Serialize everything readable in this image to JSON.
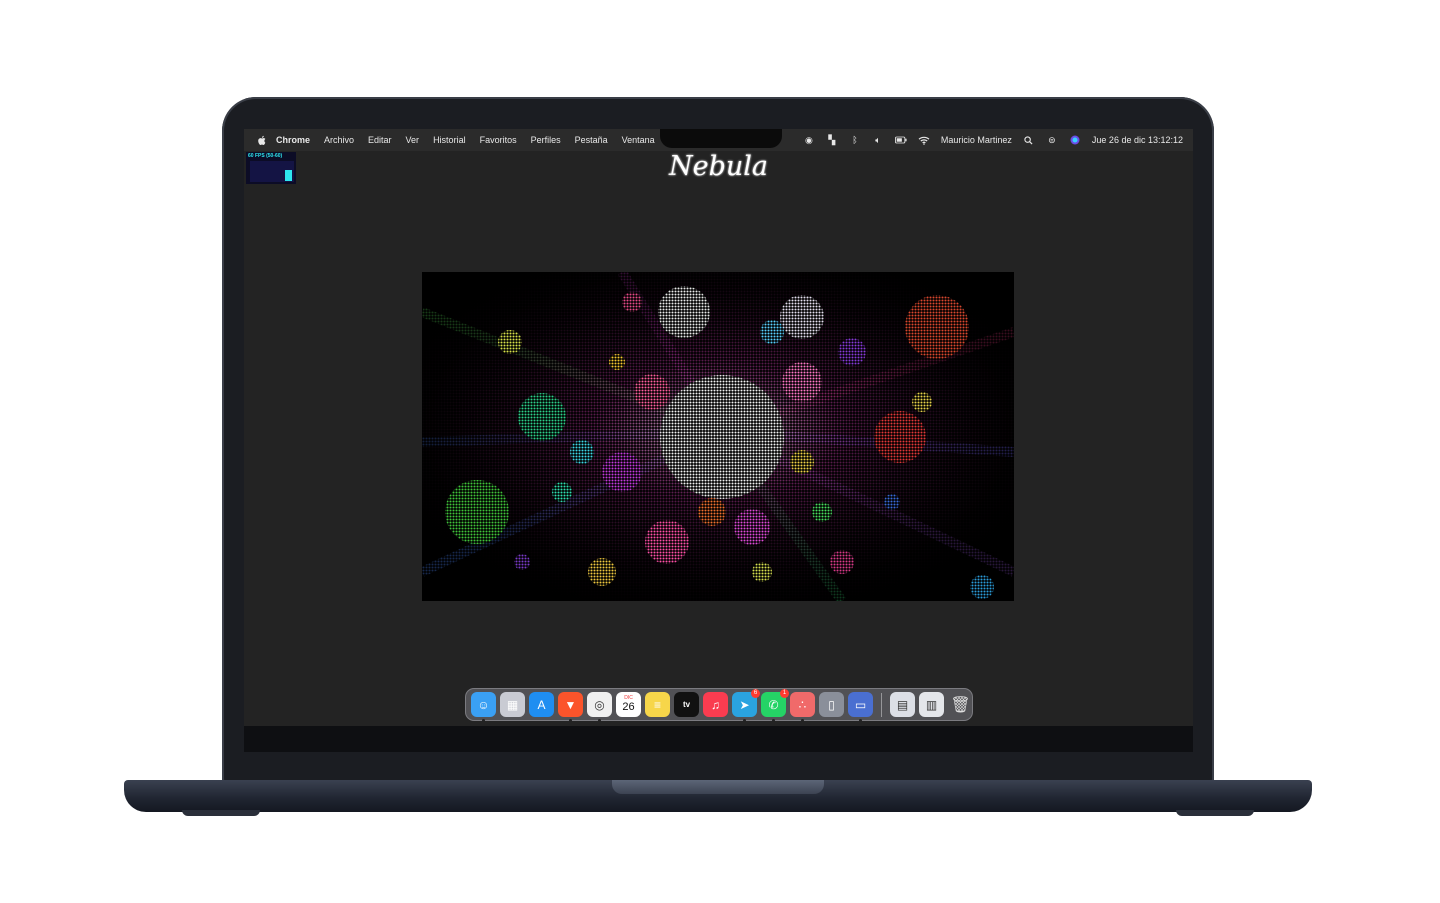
{
  "menubar": {
    "apple_icon": "apple-logo-icon",
    "items": [
      "Chrome",
      "Archivo",
      "Editar",
      "Ver",
      "Historial",
      "Favoritos",
      "Perfiles",
      "Pestaña",
      "Ventana"
    ],
    "status": {
      "user": "Mauricio Martinez",
      "datetime": "Jue 26 de dic  13:12:12"
    }
  },
  "fps": {
    "label": "60 FPS (50-60)"
  },
  "page": {
    "title": "Nebula"
  },
  "dock": {
    "apps": [
      {
        "name": "finder",
        "icon": "finder-icon",
        "glyph": "☺",
        "bg": "#3aa0f4",
        "running": true
      },
      {
        "name": "launchpad",
        "icon": "launchpad-icon",
        "glyph": "▦",
        "bg": "#c9cbd3",
        "running": false
      },
      {
        "name": "app-store",
        "icon": "app-store-icon",
        "glyph": "A",
        "bg": "#1f8ef1",
        "running": false
      },
      {
        "name": "brave",
        "icon": "brave-icon",
        "glyph": "▼",
        "bg": "#fb542b",
        "running": true
      },
      {
        "name": "chrome",
        "icon": "chrome-icon",
        "glyph": "◎",
        "bg": "#f0f0f0",
        "running": true
      },
      {
        "name": "calendar",
        "icon": "calendar-icon",
        "month": "DIC",
        "day": "26",
        "bg": "#ffffff",
        "running": false
      },
      {
        "name": "notes",
        "icon": "notes-icon",
        "glyph": "≡",
        "bg": "#f7d64a",
        "running": false
      },
      {
        "name": "apple-tv",
        "icon": "apple-tv-icon",
        "glyph": "tv",
        "bg": "#111111",
        "running": false
      },
      {
        "name": "music",
        "icon": "music-icon",
        "glyph": "♫",
        "bg": "#fa3c50",
        "running": false
      },
      {
        "name": "telegram",
        "icon": "telegram-icon",
        "glyph": "➤",
        "bg": "#2aa3e0",
        "running": true,
        "badge": "6"
      },
      {
        "name": "whatsapp",
        "icon": "whatsapp-icon",
        "glyph": "✆",
        "bg": "#25d366",
        "running": true,
        "badge": "1"
      },
      {
        "name": "asana",
        "icon": "asana-icon",
        "glyph": "∴",
        "bg": "#f06a6a",
        "running": true
      },
      {
        "name": "iphone-mirroring",
        "icon": "iphone-mirroring-icon",
        "glyph": "▯",
        "bg": "#8a8f9a",
        "running": false
      },
      {
        "name": "screen-sharing",
        "icon": "screen-sharing-icon",
        "glyph": "▭",
        "bg": "#4a6fd1",
        "running": true
      }
    ],
    "others": [
      {
        "name": "preview-stack",
        "icon": "document-stack-icon",
        "glyph": "▤",
        "bg": "#dcdfe6"
      },
      {
        "name": "downloads-stack",
        "icon": "downloads-stack-icon",
        "glyph": "▥",
        "bg": "#e4e6ea"
      },
      {
        "name": "trash",
        "icon": "trash-icon",
        "glyph": "🗑",
        "bg": "transparent"
      }
    ]
  }
}
